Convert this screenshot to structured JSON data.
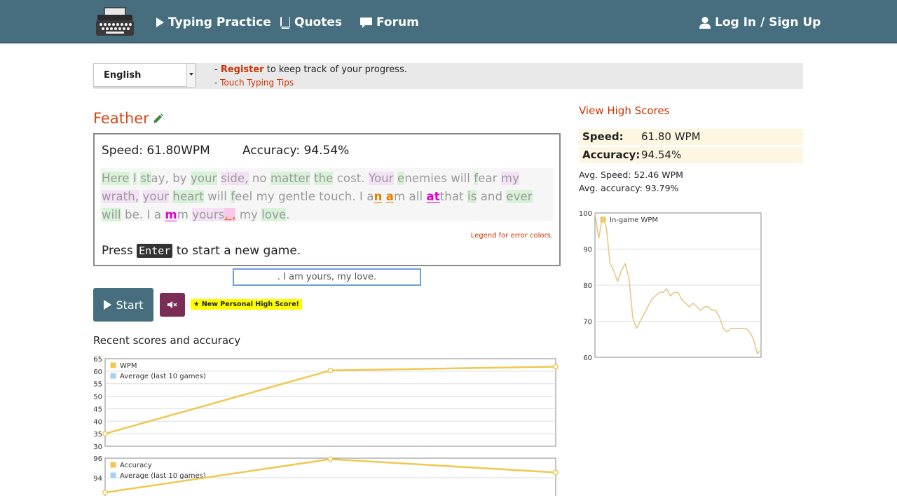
{
  "nav": {
    "typing_practice": "Typing Practice",
    "quotes": "Quotes",
    "forum": "Forum",
    "login": "Log In / Sign Up"
  },
  "language": {
    "selected": "English"
  },
  "info": {
    "dash1": "- ",
    "register": "Register",
    "register_rest": " to keep track of your progress.",
    "dash2": "- ",
    "tips": "Touch Typing Tips"
  },
  "quote": {
    "title": "Feather"
  },
  "game": {
    "speed": "Speed: 61.80WPM",
    "accuracy": "Accuracy: 94.54%",
    "legend": "Legend for error colors.",
    "press": "Press",
    "enter": "Enter",
    "press_rest": "to start a new game.",
    "segments": [
      {
        "t": "Here",
        "c": "g"
      },
      {
        "t": " ",
        "c": ""
      },
      {
        "t": "I",
        "c": "g"
      },
      {
        "t": " ",
        "c": ""
      },
      {
        "t": "st",
        "c": "g"
      },
      {
        "t": "ay, by ",
        "c": ""
      },
      {
        "t": "your",
        "c": "g"
      },
      {
        "t": " ",
        "c": ""
      },
      {
        "t": "side",
        "c": "p"
      },
      {
        "t": ",",
        "c": "p"
      },
      {
        "t": " no ",
        "c": ""
      },
      {
        "t": "matter",
        "c": "g"
      },
      {
        "t": " ",
        "c": ""
      },
      {
        "t": "the",
        "c": "g"
      },
      {
        "t": " cost. ",
        "c": ""
      },
      {
        "t": "Your",
        "c": "p"
      },
      {
        "t": " ",
        "c": ""
      },
      {
        "t": "e",
        "c": "g"
      },
      {
        "t": "nemies will ",
        "c": ""
      },
      {
        "t": "f",
        "c": "g"
      },
      {
        "t": "ear ",
        "c": ""
      },
      {
        "t": "my",
        "c": "p"
      },
      {
        "t": " ",
        "c": ""
      },
      {
        "t": "wrath,",
        "c": "p"
      },
      {
        "t": " ",
        "c": ""
      },
      {
        "t": "your",
        "c": "p"
      },
      {
        "t": " ",
        "c": ""
      },
      {
        "t": "heart",
        "c": "g"
      },
      {
        "t": " will ",
        "c": ""
      },
      {
        "t": "f",
        "c": "g"
      },
      {
        "t": "eel my gentle touch. I a",
        "c": ""
      },
      {
        "t": "n",
        "c": "o"
      },
      {
        "t": " ",
        "c": ""
      },
      {
        "t": "a",
        "c": "o"
      },
      {
        "t": "m all ",
        "c": ""
      },
      {
        "t": "at",
        "c": "m"
      },
      {
        "t": "that ",
        "c": ""
      },
      {
        "t": "is",
        "c": "g"
      },
      {
        "t": " and ",
        "c": ""
      },
      {
        "t": "ever",
        "c": "g"
      },
      {
        "t": " ",
        "c": ""
      },
      {
        "t": "will",
        "c": "g"
      },
      {
        "t": " be. I a ",
        "c": ""
      },
      {
        "t": "m",
        "c": "m"
      },
      {
        "t": "m ",
        "c": ""
      },
      {
        "t": "yours",
        "c": "p"
      },
      {
        "t": ". ,",
        "c": "hl"
      },
      {
        "t": " my ",
        "c": ""
      },
      {
        "t": "love",
        "c": "g"
      },
      {
        "t": ".",
        "c": ""
      }
    ]
  },
  "input": {
    "value": ". I am yours, my love."
  },
  "controls": {
    "start": "Start",
    "badge": "★ New Personal High Score!"
  },
  "recent": {
    "title": "Recent scores and accuracy"
  },
  "highscores": {
    "link": "View High Scores",
    "speed_label": "Speed:",
    "speed_value": "61.80 WPM",
    "acc_label": "Accuracy:",
    "acc_value": "94.54%",
    "avg_speed": "Avg. Speed: 52.46 WPM",
    "avg_acc": "Avg. accuracy: 93.79%"
  },
  "colors": {
    "accent": "#466e7e",
    "series_gold": "#f0c850",
    "series_blue": "#a8d0f0",
    "link_red": "#cc3300"
  },
  "chart_data": [
    {
      "type": "line",
      "x": [
        1,
        2,
        3
      ],
      "series": [
        {
          "name": "WPM",
          "values": [
            35,
            60.3,
            61.8
          ]
        },
        {
          "name": "Average (last 10 games)",
          "values": []
        }
      ],
      "ylim": [
        30,
        65
      ],
      "yticks": [
        30,
        35,
        40,
        45,
        50,
        55,
        60,
        65
      ],
      "legend": "top-left",
      "grid": true
    },
    {
      "type": "line",
      "x": [
        1,
        2,
        3
      ],
      "series": [
        {
          "name": "Accuracy",
          "values": [
            92.5,
            95.9,
            94.54
          ]
        },
        {
          "name": "Average (last 10 games)",
          "values": []
        }
      ],
      "ylim": [
        92,
        96
      ],
      "yticks": [
        94,
        96
      ],
      "legend": "top-left",
      "grid": true
    },
    {
      "type": "line",
      "series": [
        {
          "name": "In-game WPM",
          "values": [
            100,
            93,
            99,
            96,
            86,
            84,
            81,
            84,
            86,
            82,
            71,
            68,
            70,
            72,
            74,
            76,
            77,
            78,
            78,
            79,
            77,
            78,
            78,
            76,
            75,
            74,
            75,
            74,
            73,
            74,
            74,
            73,
            73,
            71,
            68,
            67,
            68,
            68,
            68,
            68,
            68,
            67,
            65,
            61,
            62
          ]
        }
      ],
      "ylim": [
        60,
        100
      ],
      "yticks": [
        60,
        70,
        80,
        90,
        100
      ],
      "legend": "top-left",
      "grid": true
    }
  ]
}
